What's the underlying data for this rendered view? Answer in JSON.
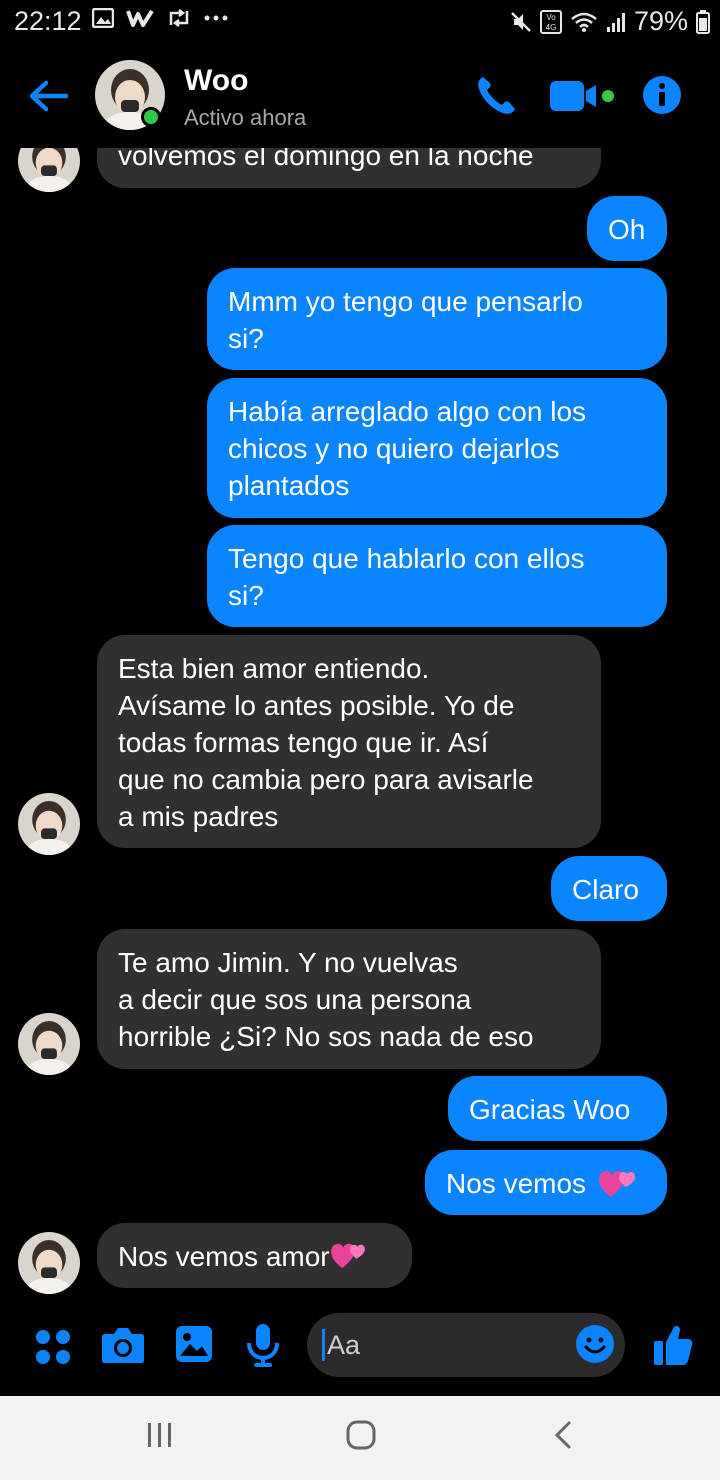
{
  "status_bar": {
    "time": "22:12",
    "battery": "79%"
  },
  "header": {
    "name": "Woo",
    "status": "Activo ahora"
  },
  "messages": [
    {
      "from": "them",
      "text": "volvemos el domingo en la noche"
    },
    {
      "from": "me",
      "text": "Oh"
    },
    {
      "from": "me",
      "lines": [
        "Mmm yo tengo que pensarlo",
        "si?"
      ]
    },
    {
      "from": "me",
      "lines": [
        "Había arreglado algo con los",
        "chicos y no quiero dejarlos",
        "plantados"
      ]
    },
    {
      "from": "me",
      "lines": [
        "Tengo que hablarlo con ellos",
        "si?"
      ]
    },
    {
      "from": "them",
      "lines": [
        "Esta bien amor entiendo.",
        "Avísame lo antes posible. Yo de",
        "todas formas tengo que ir.  Así",
        "que no cambia pero para avisarle",
        "a mis padres"
      ]
    },
    {
      "from": "me",
      "text": "Claro"
    },
    {
      "from": "them",
      "lines": [
        "Te amo Jimin. Y no vuelvas",
        "a decir que sos una persona",
        "horrible ¿Si? No sos nada de eso"
      ]
    },
    {
      "from": "me",
      "text": "Gracias Woo"
    },
    {
      "from": "me",
      "text": "Nos vemos"
    },
    {
      "from": "them",
      "text": "Nos vemos amor"
    }
  ],
  "composer": {
    "placeholder": "Aa"
  },
  "colors": {
    "accent": "#0a84ff",
    "incoming_bubble": "#303030",
    "online": "#31cc46"
  },
  "icons": [
    "back-arrow-icon",
    "phone-icon",
    "video-camera-icon",
    "info-icon",
    "menu-dots-icon",
    "camera-icon",
    "gallery-icon",
    "microphone-icon",
    "emoji-icon",
    "thumbs-up-icon"
  ]
}
